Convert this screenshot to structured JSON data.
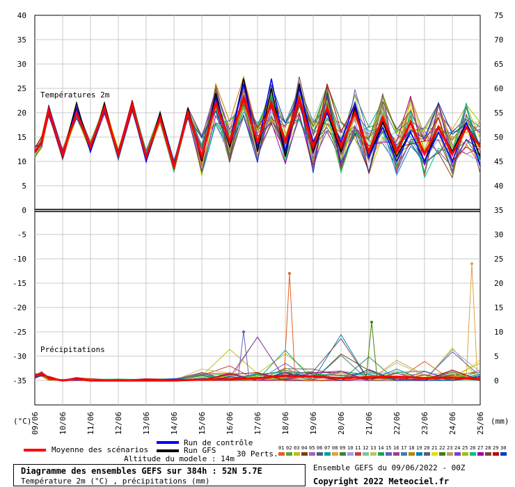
{
  "chart_data": {
    "type": "line",
    "top_panel": {
      "label": "Températures 2m",
      "y_left_ticks": [
        "40",
        "35",
        "30",
        "25",
        "20",
        "15",
        "10",
        "5",
        "0",
        "-5",
        "-10",
        "-15",
        "-20",
        "-25",
        "-30",
        "-35"
      ],
      "y_right_ticks": [
        "75",
        "70",
        "65",
        "60",
        "55",
        "50",
        "45",
        "40",
        "35",
        "30",
        "25",
        "20",
        "15",
        "10",
        "5",
        "0"
      ],
      "x_tick_labels": [
        "09/06",
        "10/06",
        "11/06",
        "12/06",
        "13/06",
        "14/06",
        "15/06",
        "16/06",
        "17/06",
        "18/06",
        "19/06",
        "20/06",
        "21/06",
        "22/06",
        "23/06",
        "24/06",
        "25/06"
      ],
      "x_range": [
        0,
        16
      ],
      "y_range": [
        -35,
        40
      ],
      "mean_temperature": [
        [
          0,
          12
        ],
        [
          0.25,
          14
        ],
        [
          0.5,
          20.5
        ],
        [
          1,
          11.5
        ],
        [
          1.5,
          20
        ],
        [
          2,
          13
        ],
        [
          2.5,
          21
        ],
        [
          3,
          11.5
        ],
        [
          3.5,
          21.5
        ],
        [
          4,
          11
        ],
        [
          4.5,
          19
        ],
        [
          5,
          9
        ],
        [
          5.5,
          20
        ],
        [
          6,
          11
        ],
        [
          6.5,
          22
        ],
        [
          7,
          14
        ],
        [
          7.5,
          23
        ],
        [
          8,
          14
        ],
        [
          8.5,
          22
        ],
        [
          9,
          14
        ],
        [
          9.5,
          23
        ],
        [
          10,
          13
        ],
        [
          10.5,
          21
        ],
        [
          11,
          13
        ],
        [
          11.5,
          20
        ],
        [
          12,
          12
        ],
        [
          12.5,
          19
        ],
        [
          13,
          12
        ],
        [
          13.5,
          18
        ],
        [
          14,
          11.5
        ],
        [
          14.5,
          17
        ],
        [
          15,
          11.5
        ],
        [
          15.5,
          17
        ],
        [
          16,
          13
        ]
      ],
      "gfs_run": [
        [
          0,
          12
        ],
        [
          0.25,
          14
        ],
        [
          0.5,
          21
        ],
        [
          1,
          11
        ],
        [
          1.5,
          22
        ],
        [
          2,
          12
        ],
        [
          2.5,
          22
        ],
        [
          3,
          11
        ],
        [
          3.5,
          22
        ],
        [
          4,
          10
        ],
        [
          4.5,
          20
        ],
        [
          5,
          9
        ],
        [
          5.5,
          21
        ],
        [
          6,
          10
        ],
        [
          6.5,
          24
        ],
        [
          7,
          13
        ],
        [
          7.5,
          27
        ],
        [
          8,
          12
        ],
        [
          8.5,
          25
        ],
        [
          9,
          11
        ],
        [
          9.5,
          26
        ],
        [
          10,
          12
        ],
        [
          10.5,
          20
        ],
        [
          11,
          12
        ],
        [
          11.5,
          21
        ],
        [
          12,
          11
        ],
        [
          12.5,
          18
        ],
        [
          13,
          11
        ],
        [
          13.5,
          16
        ],
        [
          14,
          10
        ],
        [
          14.5,
          17
        ],
        [
          15,
          12
        ],
        [
          15.5,
          18
        ],
        [
          16,
          11
        ]
      ],
      "control_run": [
        [
          0,
          12
        ],
        [
          0.25,
          14
        ],
        [
          0.5,
          20
        ],
        [
          1,
          11
        ],
        [
          1.5,
          21
        ],
        [
          2,
          12
        ],
        [
          2.5,
          21
        ],
        [
          3,
          11
        ],
        [
          3.5,
          21
        ],
        [
          4,
          10
        ],
        [
          4.5,
          19
        ],
        [
          5,
          9
        ],
        [
          5.5,
          20
        ],
        [
          6,
          11
        ],
        [
          6.5,
          23
        ],
        [
          7,
          14
        ],
        [
          7.5,
          26
        ],
        [
          8,
          13
        ],
        [
          8.5,
          27
        ],
        [
          9,
          12
        ],
        [
          9.5,
          25
        ],
        [
          10,
          14
        ],
        [
          10.5,
          20
        ],
        [
          11,
          14
        ],
        [
          11.5,
          22
        ],
        [
          12,
          11
        ],
        [
          12.5,
          17
        ],
        [
          13,
          10
        ],
        [
          13.5,
          16
        ],
        [
          14,
          10
        ],
        [
          14.5,
          16
        ],
        [
          15,
          10
        ],
        [
          15.5,
          18
        ],
        [
          16,
          9
        ]
      ]
    },
    "bottom_panel": {
      "label": "Précipitations",
      "y_right_ticks": [
        "25",
        "20",
        "15",
        "10",
        "5",
        "0"
      ],
      "y_range_mm": [
        0,
        25
      ],
      "mean_precipitation": [
        [
          0,
          1
        ],
        [
          0.25,
          1.5
        ],
        [
          0.5,
          0.5
        ],
        [
          1,
          0
        ],
        [
          1.5,
          0.3
        ],
        [
          2,
          0
        ],
        [
          3,
          0
        ],
        [
          4,
          0
        ],
        [
          5,
          0
        ],
        [
          6,
          0.2
        ],
        [
          7,
          0.3
        ],
        [
          8,
          0.5
        ],
        [
          9,
          1
        ],
        [
          10,
          0.8
        ],
        [
          11,
          0.5
        ],
        [
          12,
          0.7
        ],
        [
          13,
          0.8
        ],
        [
          14,
          0.5
        ],
        [
          15,
          0.6
        ],
        [
          16,
          0.3
        ]
      ],
      "notable_peaks": [
        {
          "member": "peak1",
          "x": 9.15,
          "mm": 22
        },
        {
          "member": "peak2",
          "x": 15.7,
          "mm": 24
        },
        {
          "member": "peak3",
          "x": 7.5,
          "mm": 10
        },
        {
          "member": "peak4",
          "x": 12.1,
          "mm": 12
        }
      ]
    },
    "legend": [
      {
        "name": "Moyenne des scénarios",
        "color": "#ff0000"
      },
      {
        "name": "Run de contrôle",
        "color": "#0000ff"
      },
      {
        "name": "Run GFS",
        "color": "#000000"
      }
    ]
  },
  "texts": {
    "unit_left": "(°C)",
    "unit_right": "(mm)",
    "altitude": "Altitude du modele : 14m",
    "perts": "30 Perts.",
    "title": "Diagramme des ensembles GEFS sur 384h : 52N 5.7E",
    "subtitle": "Température 2m (°C) , précipitations (mm)",
    "run": "Ensemble GEFS du 09/06/2022 - 00Z",
    "copyright": "Copyright 2022 Meteociel.fr",
    "legend_mean": "Moyenne des scénarios",
    "legend_control": "Run de contrôle",
    "legend_gfs": "Run GFS"
  },
  "perturbations": [
    "01",
    "02",
    "03",
    "04",
    "05",
    "06",
    "07",
    "08",
    "09",
    "10",
    "11",
    "12",
    "13",
    "14",
    "15",
    "16",
    "17",
    "18",
    "19",
    "20",
    "21",
    "22",
    "23",
    "24",
    "25",
    "26",
    "27",
    "28",
    "29",
    "30"
  ],
  "pert_colors": [
    "#e06020",
    "#60a040",
    "#c0c000",
    "#804000",
    "#a060c0",
    "#406080",
    "#00a0a0",
    "#e0a040",
    "#408040",
    "#a0a0e0",
    "#c04040",
    "#80c0a0",
    "#c0c060",
    "#20a060",
    "#6060c0",
    "#a04080",
    "#4080a0",
    "#c08000",
    "#0080c0",
    "#606060",
    "#e0e000",
    "#408000",
    "#c0a060",
    "#8040c0",
    "#a0c000",
    "#00c080",
    "#a000a0",
    "#804040",
    "#c00000",
    "#0040c0"
  ]
}
